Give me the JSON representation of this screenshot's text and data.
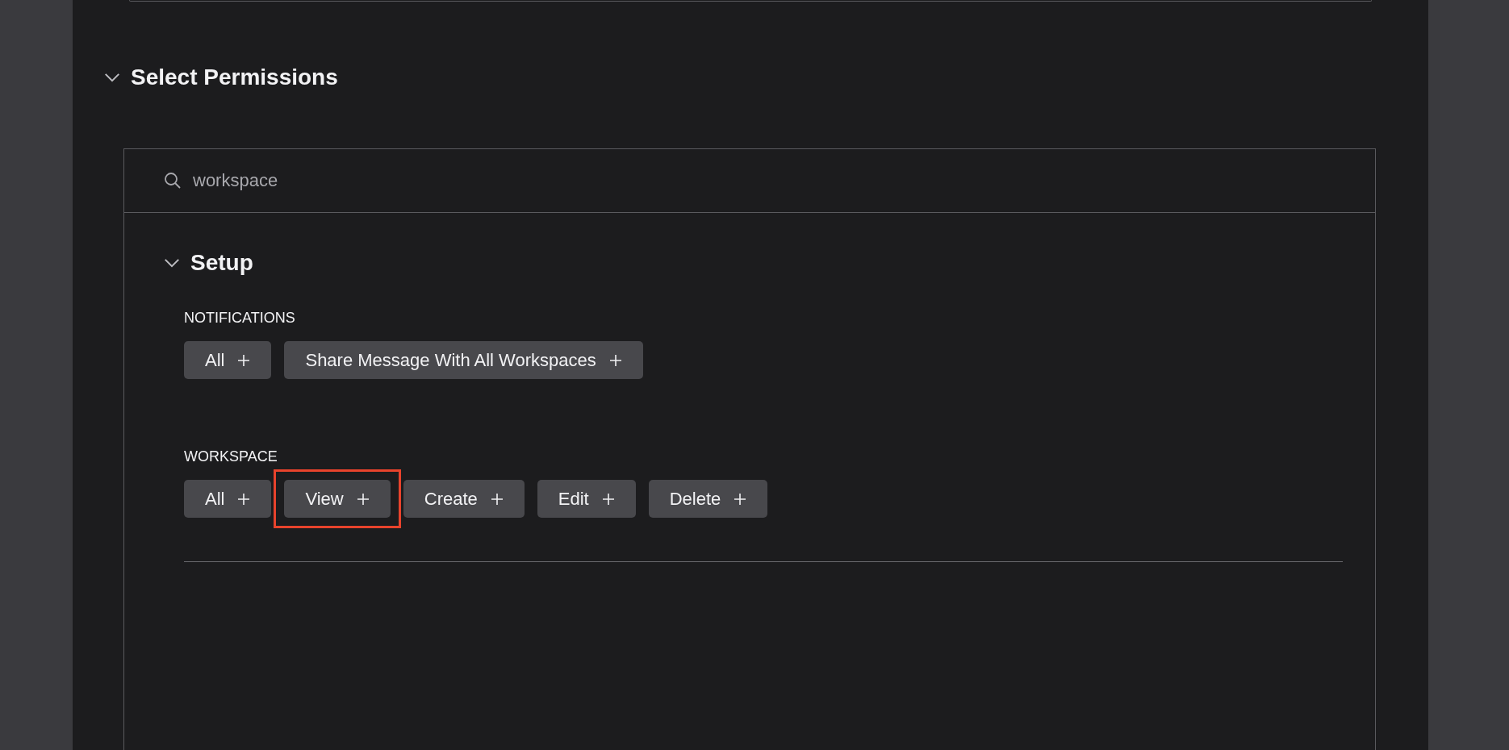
{
  "section": {
    "title": "Select Permissions",
    "expanded": true
  },
  "search": {
    "value": "workspace"
  },
  "groups": [
    {
      "title": "Setup",
      "expanded": true,
      "categories": [
        {
          "label": "NOTIFICATIONS",
          "chips": [
            {
              "label": "All",
              "highlighted": false
            },
            {
              "label": "Share Message With All Workspaces",
              "highlighted": false
            }
          ]
        },
        {
          "label": "WORKSPACE",
          "chips": [
            {
              "label": "All",
              "highlighted": false
            },
            {
              "label": "View",
              "highlighted": true
            },
            {
              "label": "Create",
              "highlighted": false
            },
            {
              "label": "Edit",
              "highlighted": false
            },
            {
              "label": "Delete",
              "highlighted": false
            }
          ]
        }
      ]
    }
  ]
}
